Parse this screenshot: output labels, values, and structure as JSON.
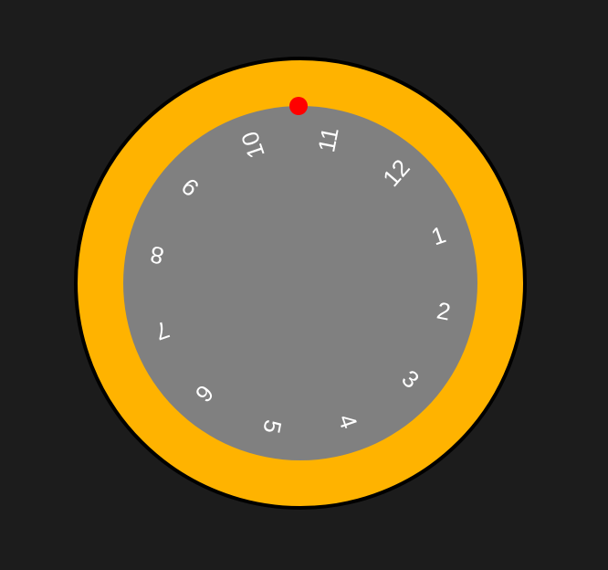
{
  "dial": {
    "numbers": [
      "1",
      "2",
      "3",
      "4",
      "5",
      "6",
      "7",
      "8",
      "9",
      "10",
      "11",
      "12"
    ],
    "colors": {
      "background": "#1c1c1c",
      "outer_ring": "#ffb300",
      "outline": "#000000",
      "face": "#808080",
      "numbers": "#ffffff",
      "marker": "#ff0000"
    }
  }
}
